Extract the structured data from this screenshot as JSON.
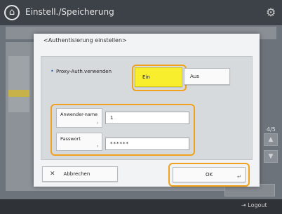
{
  "header": {
    "title": "Einstell./Speicherung",
    "app_icon": "home-icon",
    "settings_icon": "gear-icon"
  },
  "background": {
    "page_indicator": "4/5",
    "footer_logout": "Logout"
  },
  "dialog": {
    "title": "<Authentisierung einstellen>",
    "proxy_auth_label": "Proxy-Auth.verwenden",
    "on_label": "Ein",
    "off_label": "Aus",
    "username_label": "Anwender-name",
    "username_value": "1",
    "password_label": "Passwort",
    "password_value": "******",
    "cancel_label": "Abbrechen",
    "ok_label": "OK"
  },
  "colors": {
    "highlight": "#f0a21f",
    "selected": "#f9ee2e"
  }
}
